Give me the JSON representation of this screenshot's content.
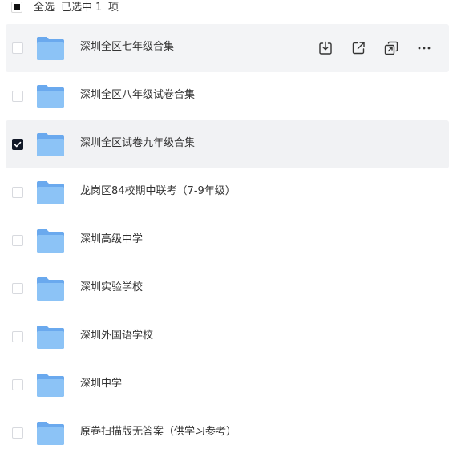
{
  "header": {
    "select_all": "全选",
    "selected_prefix": "已选中",
    "selected_count": "1",
    "selected_unit": "项"
  },
  "folders": [
    {
      "name": "深圳全区七年级合集",
      "checked": false
    },
    {
      "name": "深圳全区八年级试卷合集",
      "checked": false
    },
    {
      "name": "深圳全区试卷九年级合集",
      "checked": true
    },
    {
      "name": "龙岗区84校期中联考（7-9年级）",
      "checked": false
    },
    {
      "name": "深圳高级中学",
      "checked": false
    },
    {
      "name": "深圳实验学校",
      "checked": false
    },
    {
      "name": "深圳外国语学校",
      "checked": false
    },
    {
      "name": "深圳中学",
      "checked": false
    },
    {
      "name": "原卷扫描版无答案（供学习参考）",
      "checked": false
    }
  ],
  "row_actions": [
    "download-icon",
    "share-icon",
    "copy-link-icon",
    "more-icon"
  ],
  "colors": {
    "folder_back": "#6aa9ee",
    "folder_front": "#8cc3f6",
    "checked_fill": "#111827",
    "hover_bg": "#f3f4f6"
  }
}
